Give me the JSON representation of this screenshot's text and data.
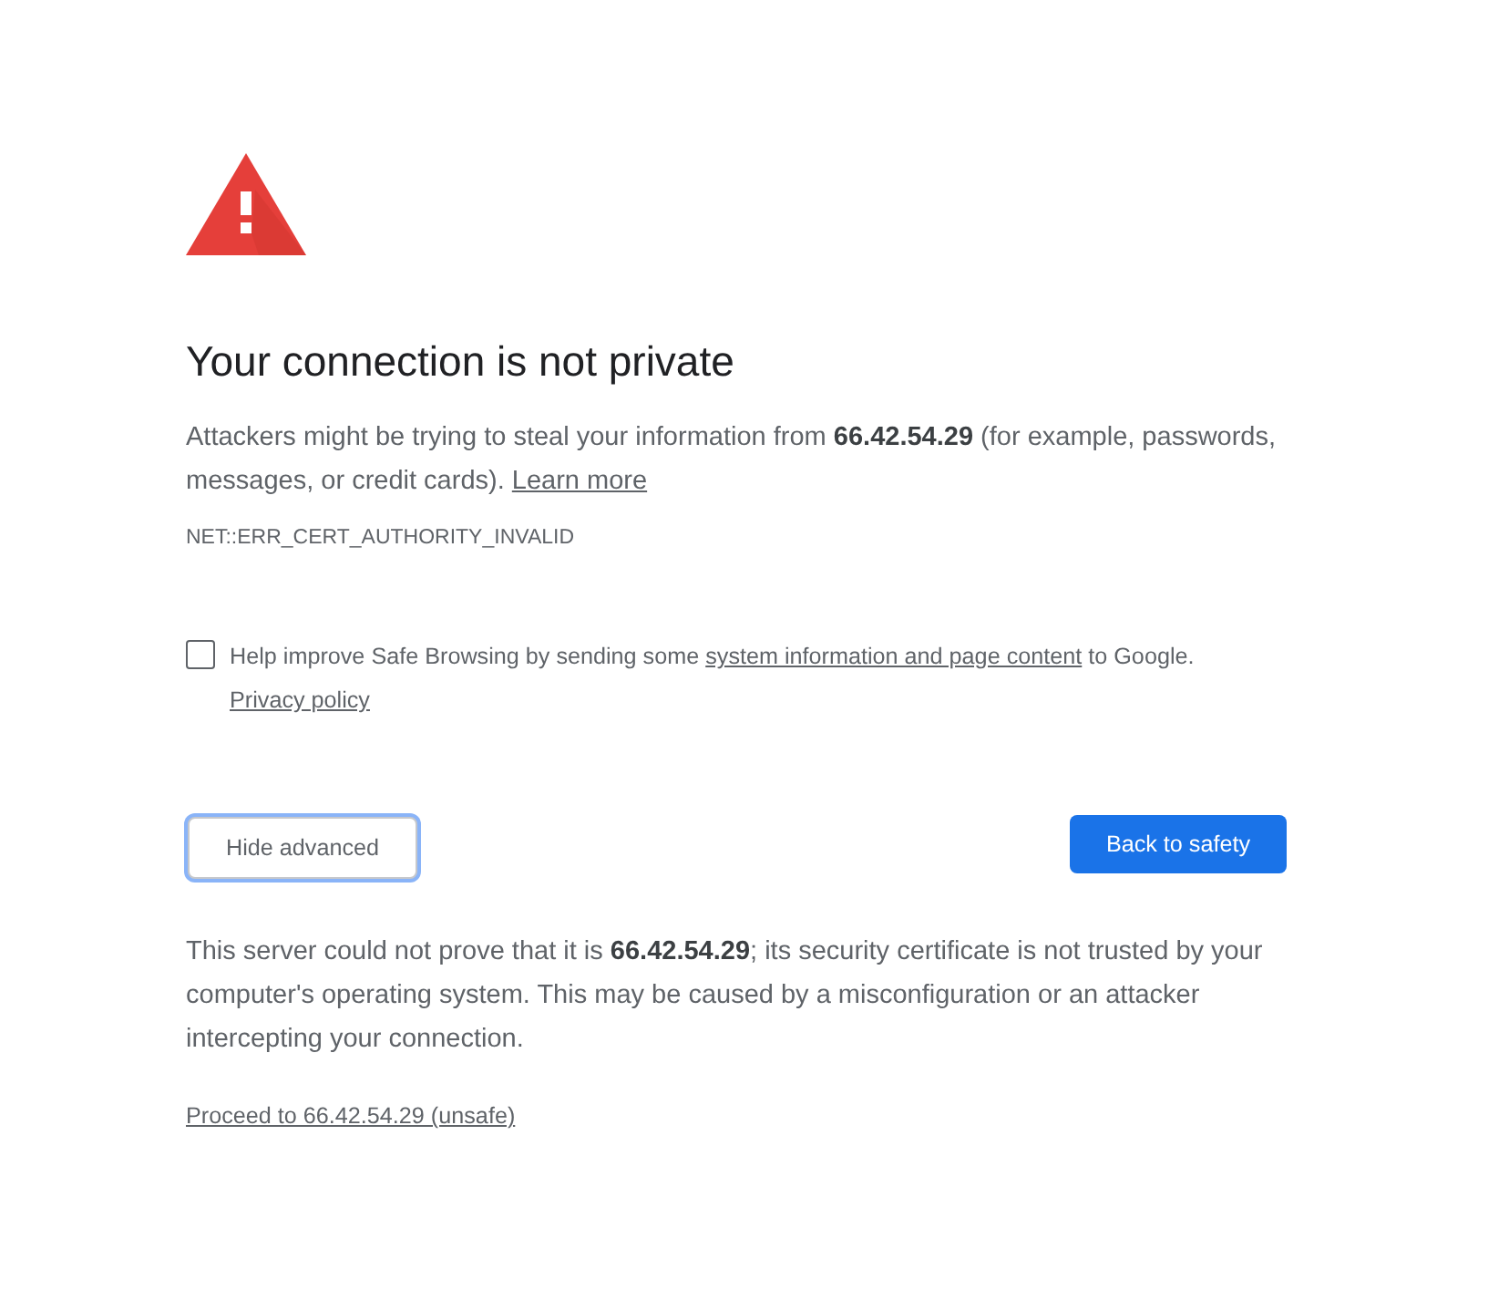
{
  "heading": "Your connection is not private",
  "intro": {
    "text": "Attackers might be trying to steal your information from **66.42.54.29** (for example, passwords, messages, or credit cards).",
    "link": "Learn more"
  },
  "error_code": "NET::ERR_CERT_AUTHORITY_INVALID",
  "opt_in": {
    "checked": false,
    "text_before": "Help improve Safe Browsing by sending some",
    "link": "system information and page content",
    "text_after": "to Google.",
    "policy_link": "Privacy policy"
  },
  "buttons": [
    {
      "kind": "secondary",
      "label": "Hide advanced",
      "focused": true
    },
    {
      "kind": "primary",
      "label": "Back to safety",
      "focused": false
    }
  ],
  "details": "This server could not prove that it is **66.42.54.29**; its security certificate is not trusted by your computer's operating system. This may be caused by a misconfiguration or an attacker intercepting your connection.",
  "proceed_link": "Proceed to 66.42.54.29 (unsafe)"
}
